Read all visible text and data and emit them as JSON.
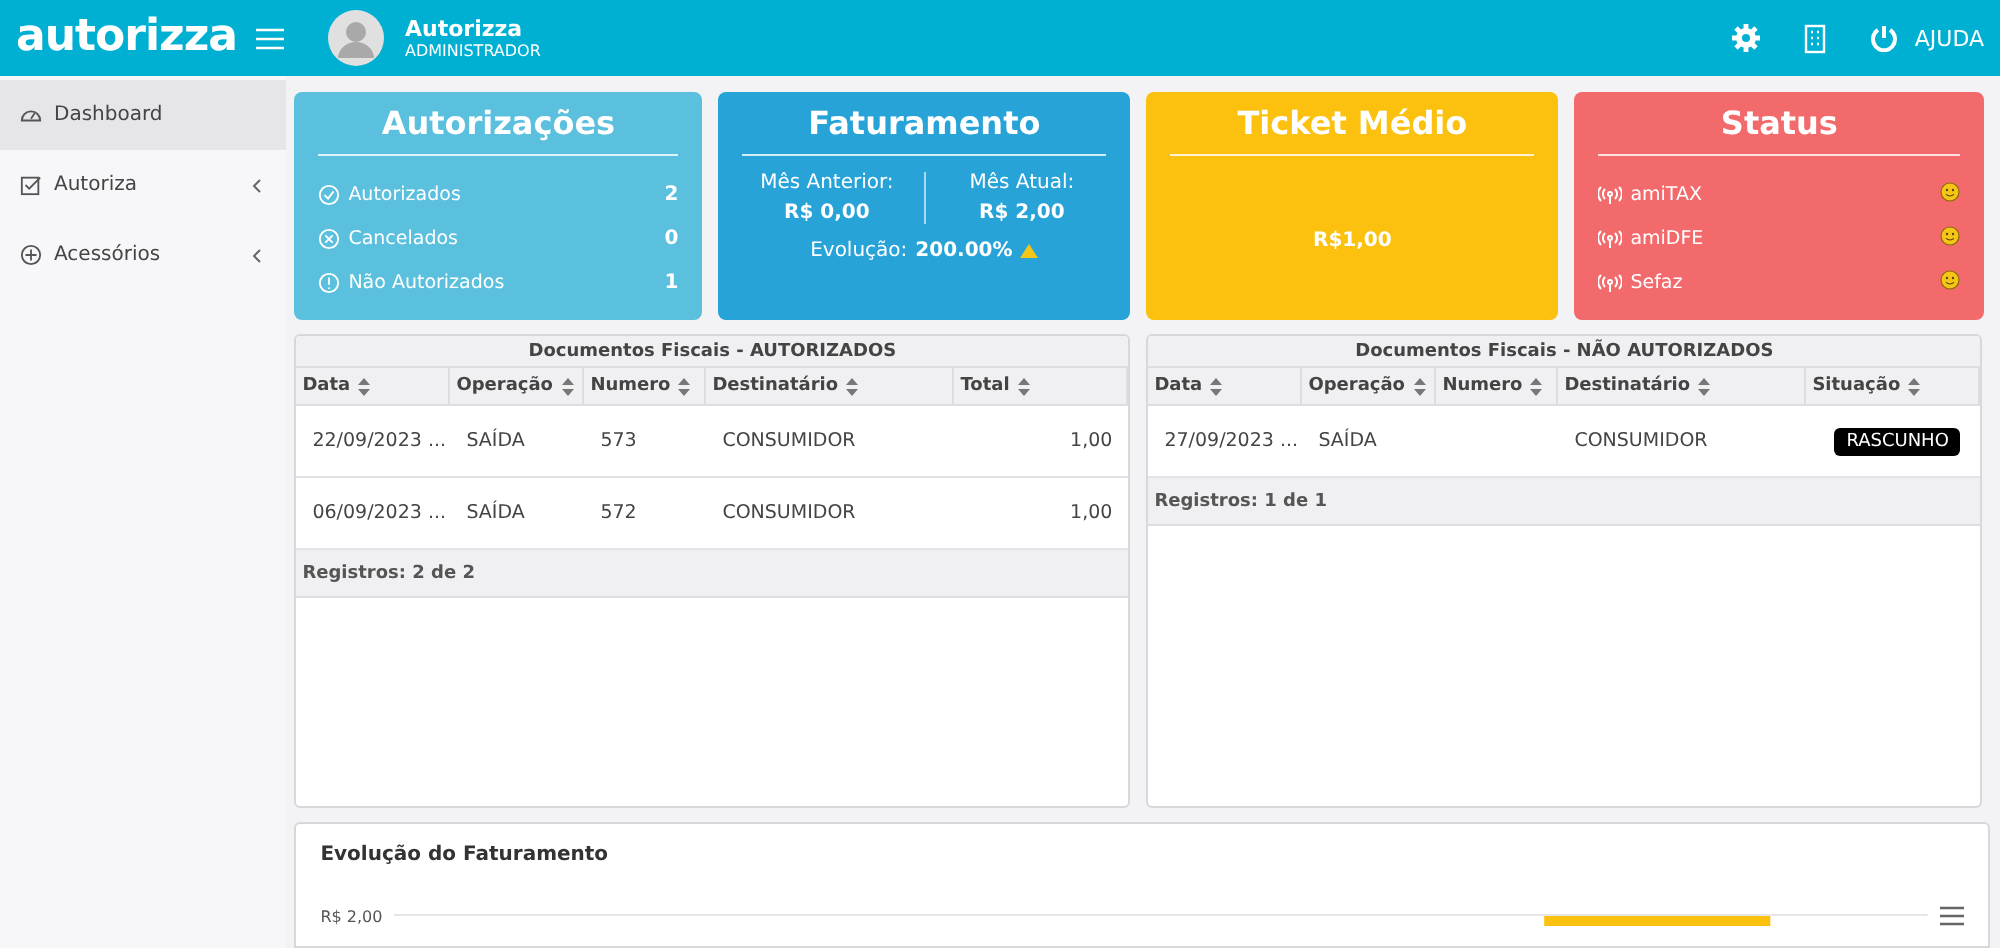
{
  "header": {
    "logo": "autorizza",
    "user_name": "Autorizza",
    "user_role": "ADMINISTRADOR",
    "help": "AJUDA"
  },
  "sidebar": {
    "items": [
      {
        "label": "Dashboard",
        "selected": true,
        "has_submenu": false
      },
      {
        "label": "Autoriza",
        "selected": false,
        "has_submenu": true
      },
      {
        "label": "Acessórios",
        "selected": false,
        "has_submenu": true
      }
    ]
  },
  "cards": [
    {
      "kind": "counts",
      "title": "Autorizações",
      "color": "#5bc0de",
      "rows": [
        {
          "label": "Autorizados",
          "value": "2"
        },
        {
          "label": "Cancelados",
          "value": "0"
        },
        {
          "label": "Não Autorizados",
          "value": "1"
        }
      ]
    },
    {
      "kind": "billing",
      "title": "Faturamento",
      "color": "#27a3d8",
      "prev_label": "Mês Anterior:",
      "prev_value": "R$ 0,00",
      "curr_label": "Mês Atual:",
      "curr_value": "R$ 2,00",
      "evolution_label": "Evolução:",
      "evolution_value": "200.00%"
    },
    {
      "kind": "single",
      "title": "Ticket Médio",
      "color": "#fcc10f",
      "value": "R$1,00"
    },
    {
      "kind": "status",
      "title": "Status",
      "color": "#f36a6c",
      "rows": [
        {
          "label": "amiTAX"
        },
        {
          "label": "amiDFE"
        },
        {
          "label": "Sefaz"
        }
      ]
    }
  ],
  "tables": [
    {
      "title": "Documentos Fiscais - AUTORIZADOS",
      "columns": [
        {
          "label": "Data",
          "kind": "text"
        },
        {
          "label": "Operação",
          "kind": "text"
        },
        {
          "label": "Numero",
          "kind": "text"
        },
        {
          "label": "Destinatário",
          "kind": "text"
        },
        {
          "label": "Total",
          "kind": "number"
        }
      ],
      "rows": [
        [
          "22/09/2023 ...",
          "SAÍDA",
          "573",
          "CONSUMIDOR",
          "1,00"
        ],
        [
          "06/09/2023 ...",
          "SAÍDA",
          "572",
          "CONSUMIDOR",
          "1,00"
        ]
      ],
      "footer": "Registros: 2 de 2"
    },
    {
      "title": "Documentos Fiscais - NÃO AUTORIZADOS",
      "columns": [
        {
          "label": "Data",
          "kind": "text"
        },
        {
          "label": "Operação",
          "kind": "text"
        },
        {
          "label": "Numero",
          "kind": "text"
        },
        {
          "label": "Destinatário",
          "kind": "text"
        },
        {
          "label": "Situação",
          "kind": "badge"
        }
      ],
      "rows": [
        [
          "27/09/2023 ...",
          "SAÍDA",
          "",
          "CONSUMIDOR",
          "RASCUNHO"
        ]
      ],
      "footer": "Registros: 1 de 1"
    }
  ],
  "chart": {
    "title": "Evolução do Faturamento",
    "ytick_label": "R$ 2,00"
  }
}
